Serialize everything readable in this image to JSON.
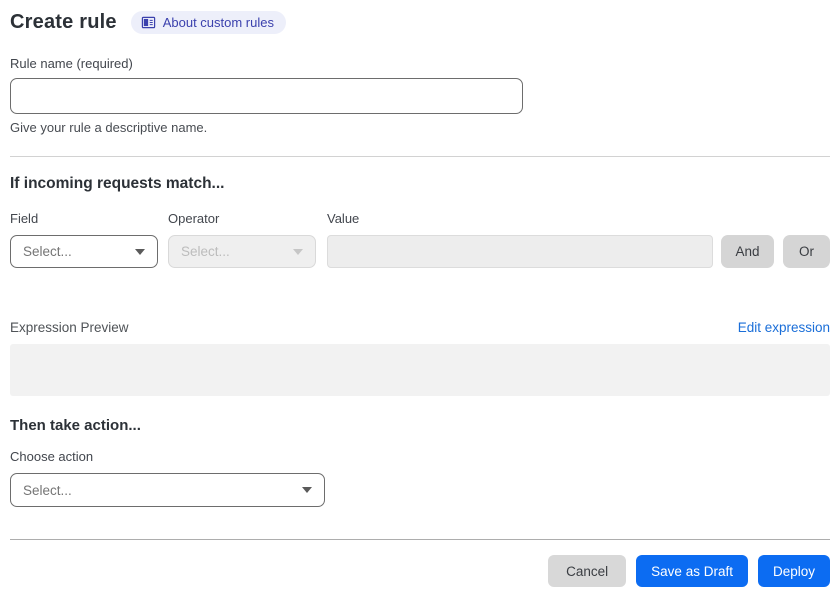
{
  "header": {
    "title": "Create rule",
    "about_badge": {
      "icon": "book-icon",
      "label": "About custom rules"
    }
  },
  "rule_name": {
    "label": "Rule name (required)",
    "value": "",
    "placeholder": "",
    "help": "Give your rule a descriptive name."
  },
  "match": {
    "heading": "If incoming requests match...",
    "field_label": "Field",
    "operator_label": "Operator",
    "value_label": "Value",
    "field_select": {
      "value": "Select...",
      "disabled": false,
      "icon": "chevron-down-icon"
    },
    "operator_select": {
      "value": "Select...",
      "disabled": true,
      "icon": "chevron-down-icon"
    },
    "value_input": {
      "value": "",
      "disabled": true
    },
    "and_label": "And",
    "or_label": "Or"
  },
  "expression": {
    "label": "Expression Preview",
    "edit_link": "Edit expression",
    "preview": ""
  },
  "action": {
    "heading": "Then take action...",
    "label": "Choose action",
    "select": {
      "value": "Select...",
      "icon": "chevron-down-icon"
    }
  },
  "footer": {
    "cancel": "Cancel",
    "save_draft": "Save as Draft",
    "deploy": "Deploy"
  },
  "colors": {
    "primary_blue": "#0c6cf2",
    "link_blue": "#1a6ed8",
    "badge_bg": "#edeffa",
    "badge_text": "#3b41ad",
    "button_gray": "#d8d8d8",
    "preview_box_bg": "#f2f2f2",
    "heading_text": "#2c3137"
  }
}
